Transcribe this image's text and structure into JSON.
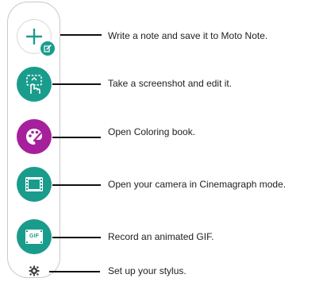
{
  "colors": {
    "teal": "#1a9c8c",
    "purple": "#a7209b",
    "outline": "#c9c9c9"
  },
  "menu": {
    "items": [
      {
        "icon": "add-note-icon",
        "label": "Write a note and save it to Moto Note."
      },
      {
        "icon": "screenshot-edit-icon",
        "label": "Take a screenshot and edit it."
      },
      {
        "icon": "palette-icon",
        "label": "Open Coloring book."
      },
      {
        "icon": "film-icon",
        "label": "Open your camera in Cinemagraph mode."
      },
      {
        "icon": "gif-icon",
        "label": "Record an animated GIF.",
        "badge_text": "GIF"
      },
      {
        "icon": "gear-icon",
        "label": "Set up your stylus."
      }
    ]
  }
}
